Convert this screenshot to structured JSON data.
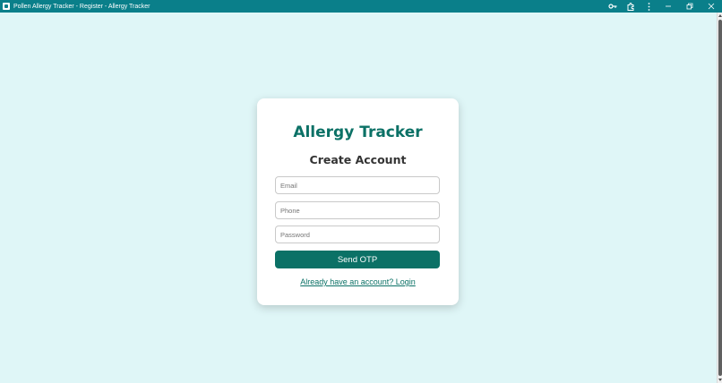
{
  "window": {
    "title": "Pollen Allergy Tracker - Register - Allergy Tracker",
    "icons": [
      "app-icon",
      "key-icon",
      "extension-icon",
      "more-vert-icon"
    ],
    "controls": [
      "minimize",
      "restore",
      "close"
    ]
  },
  "card": {
    "brand": "Allergy Tracker",
    "heading": "Create Account",
    "email_placeholder": "Email",
    "phone_placeholder": "Phone",
    "password_placeholder": "Password",
    "submit_label": "Send OTP",
    "login_link": "Already have an account? Login"
  },
  "colors": {
    "titlebar": "#0a7f8a",
    "background": "#dff6f7",
    "accent": "#0b7166",
    "card": "#ffffff"
  }
}
